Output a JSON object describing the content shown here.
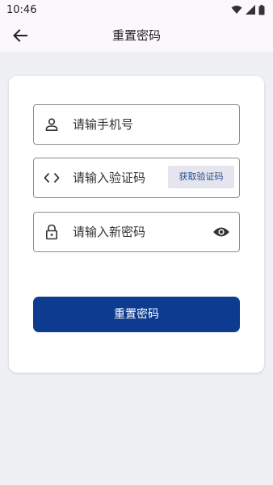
{
  "status_bar": {
    "time": "10:46",
    "icons": [
      "wifi-icon",
      "signal-icon",
      "battery-icon"
    ]
  },
  "app_bar": {
    "back_icon": "arrow-left-icon",
    "title": "重置密码"
  },
  "form": {
    "phone": {
      "icon": "person-icon",
      "placeholder": "请输手机号",
      "value": ""
    },
    "code": {
      "icon": "code-brackets-icon",
      "placeholder": "请输入验证码",
      "value": "",
      "get_code_label": "获取验证码"
    },
    "password": {
      "icon": "lock-icon",
      "placeholder": "请输入新密码",
      "value": "",
      "toggle_icon": "eye-icon"
    },
    "submit_label": "重置密码"
  },
  "colors": {
    "primary": "#0d3b90",
    "background": "#eef0f4",
    "card": "#ffffff",
    "code_button_bg": "#e4e5ee",
    "code_button_text": "#2a4b8d"
  }
}
